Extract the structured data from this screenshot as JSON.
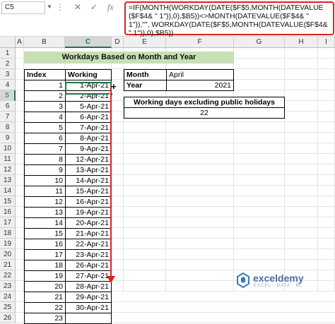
{
  "formula_bar": {
    "name_box": "C5",
    "formula": "=IF(MONTH(WORKDAY(DATE($F$5,MONTH(DATEVALUE($F$4& \" 1\")),0),$B5))<>MONTH(DATEVALUE($F$4& \" 1\")),\"\", WORKDAY(DATE($F$5,MONTH(DATEVALUE($F$4& \" 1\")),0),$B5))",
    "icon_dots": "⋮",
    "icon_cancel": "✕",
    "icon_enter": "✓",
    "icon_fx": "fx"
  },
  "columns": [
    "A",
    "B",
    "C",
    "D",
    "E",
    "F",
    "G",
    "H",
    "I"
  ],
  "rows": [
    "1",
    "2",
    "3",
    "4",
    "5",
    "6",
    "7",
    "8",
    "9",
    "10",
    "11",
    "12",
    "13",
    "14",
    "15",
    "16",
    "17",
    "18",
    "19",
    "20",
    "21",
    "22",
    "23",
    "24",
    "25",
    "26"
  ],
  "title": "Workdays Based on Month and Year",
  "table": {
    "headers": [
      "Index",
      "Working Days"
    ],
    "rows": [
      [
        "1",
        "1-Apr-21"
      ],
      [
        "2",
        "2-Apr-21"
      ],
      [
        "3",
        "5-Apr-21"
      ],
      [
        "4",
        "6-Apr-21"
      ],
      [
        "5",
        "7-Apr-21"
      ],
      [
        "6",
        "8-Apr-21"
      ],
      [
        "7",
        "9-Apr-21"
      ],
      [
        "8",
        "12-Apr-21"
      ],
      [
        "9",
        "13-Apr-21"
      ],
      [
        "10",
        "14-Apr-21"
      ],
      [
        "11",
        "15-Apr-21"
      ],
      [
        "12",
        "16-Apr-21"
      ],
      [
        "13",
        "19-Apr-21"
      ],
      [
        "14",
        "20-Apr-21"
      ],
      [
        "15",
        "21-Apr-21"
      ],
      [
        "16",
        "22-Apr-21"
      ],
      [
        "17",
        "23-Apr-21"
      ],
      [
        "18",
        "26-Apr-21"
      ],
      [
        "19",
        "27-Apr-21"
      ],
      [
        "20",
        "28-Apr-21"
      ],
      [
        "21",
        "29-Apr-21"
      ],
      [
        "22",
        "30-Apr-21"
      ],
      [
        "23",
        ""
      ]
    ]
  },
  "inputs": {
    "month_label": "Month",
    "month_value": "April",
    "year_label": "Year",
    "year_value": "2021"
  },
  "summary": {
    "label": "Working days excluding public holidays",
    "value": "22"
  },
  "watermark": {
    "brand": "exceldemy",
    "tagline": "EXCEL · DATA · BI"
  },
  "colors": {
    "title_fill": "#c6e0b4",
    "accent": "#217346",
    "annotation": "#e0201b"
  }
}
